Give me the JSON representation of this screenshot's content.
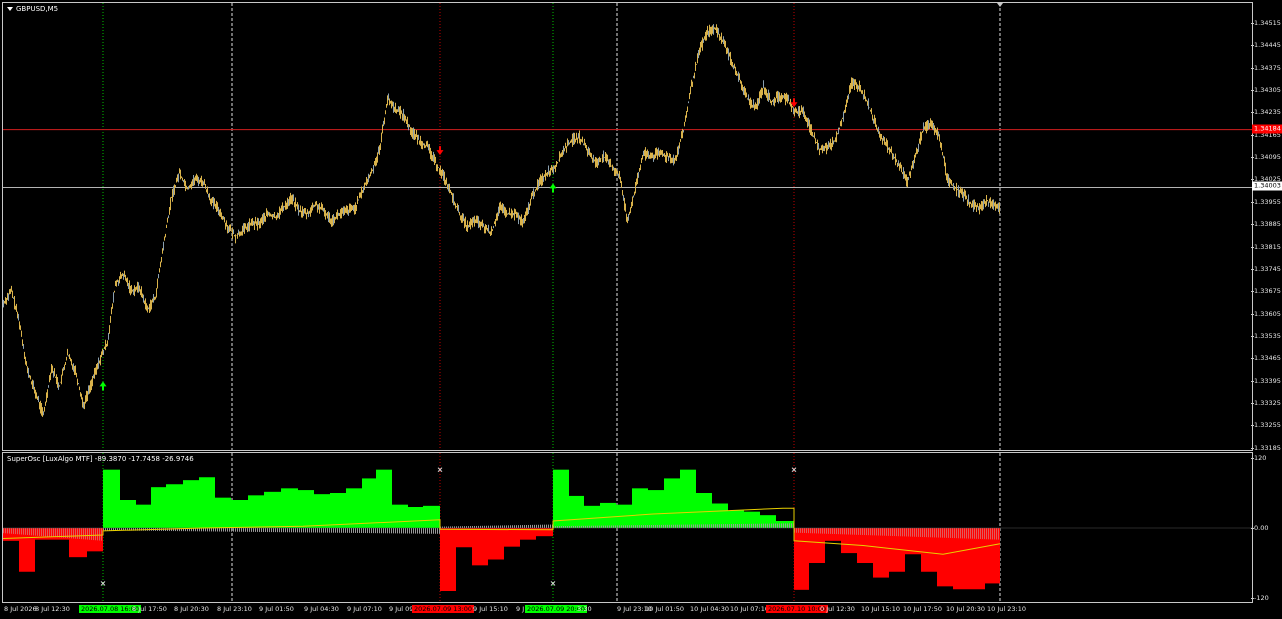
{
  "chart_title": "GBPUSD,M5",
  "osc_title": "SuperOsc [LuxAlgo MTF] -89.3870 -17.7458 -26.9746",
  "colors": {
    "bull": "#00ff00",
    "bear": "#ff0000",
    "candle": "#d9b24a",
    "signal": "#e8d000",
    "neutral_hist": "#9a9a9a",
    "red_line": "#d21e1e",
    "grid_white": "#e0e0e0",
    "tag_red": "#ff0000",
    "tag_green": "#00ff00"
  },
  "price_axis": {
    "ticks": [
      "1.34515",
      "1.34445",
      "1.34375",
      "1.34305",
      "1.34235",
      "1.34165",
      "1.34095",
      "1.34025",
      "1.33955",
      "1.33885",
      "1.33815",
      "1.33745",
      "1.33675",
      "1.33605",
      "1.33535",
      "1.33465",
      "1.33395",
      "1.33325",
      "1.33255",
      "1.33185"
    ],
    "red_line_label": "1.34184",
    "white_line_label": "1.34003"
  },
  "osc_axis": {
    "ticks": [
      "120",
      "0.00",
      "-120"
    ]
  },
  "time_axis": {
    "labels": [
      "8 Jul 2026",
      "8 Jul 12:30",
      "2026.07.08 16:00",
      "8 Jul 17:50",
      "8 Jul 20:30",
      "8 Jul 23:10",
      "9 Jul 01:50",
      "9 Jul 04:30",
      "9 Jul 07:10",
      "9 Jul 09:",
      "2026.07.09 13:00",
      "9 Jul 15:10",
      "9 J",
      "2026.07.09 20:00",
      "3:30",
      "9 Jul 23:10",
      "10 Jul 01:50",
      "10 Jul 04:30",
      "10 Jul 07:10",
      "2026.07.10 10:00",
      "0 Jul 12:30",
      "10 Jul 15:10",
      "10 Jul 17:50",
      "10 Jul 20:30",
      "10 Jul 23:10"
    ]
  },
  "chart_data": [
    {
      "type": "line",
      "title": "GBPUSD,M5",
      "ylim": [
        1.3316,
        1.3455
      ],
      "horizontal_lines": [
        1.34184,
        1.34003
      ],
      "series": [
        {
          "name": "GBPUSD,M5",
          "x": [
            0,
            8,
            16,
            24,
            32,
            40,
            48,
            56,
            64,
            72,
            80,
            88,
            96,
            104,
            112,
            120,
            128,
            136,
            144,
            152,
            160,
            168,
            176,
            184,
            192,
            200,
            208,
            216,
            224,
            232,
            240,
            248,
            256,
            264,
            272,
            280,
            288,
            296,
            304,
            312,
            320,
            328,
            336,
            344,
            352,
            360,
            368,
            376,
            384,
            392,
            400,
            408,
            416,
            424,
            432,
            440,
            448,
            456,
            464,
            472,
            480,
            488,
            496,
            504,
            512,
            520,
            528,
            536,
            544,
            552,
            560,
            568,
            576,
            584,
            592,
            600,
            608,
            616,
            624,
            632,
            640,
            648,
            656,
            664,
            672,
            680,
            688,
            696,
            704,
            712,
            720,
            728,
            736,
            744,
            752,
            760,
            768,
            776,
            784,
            792,
            800,
            808,
            816,
            824,
            832,
            840,
            848,
            856,
            864,
            872,
            880,
            888,
            896,
            904,
            912,
            920,
            928,
            936,
            944,
            952,
            960,
            968,
            976,
            984,
            992,
            997
          ],
          "y": [
            1.3364,
            1.3368,
            1.3358,
            1.3343,
            1.3336,
            1.3329,
            1.3344,
            1.3338,
            1.3348,
            1.3343,
            1.3332,
            1.3339,
            1.3346,
            1.3352,
            1.337,
            1.3373,
            1.3368,
            1.3369,
            1.3362,
            1.3366,
            1.3382,
            1.3397,
            1.3405,
            1.34,
            1.3403,
            1.3402,
            1.3396,
            1.3393,
            1.3388,
            1.3385,
            1.3387,
            1.3389,
            1.3389,
            1.3392,
            1.3391,
            1.3394,
            1.3397,
            1.3393,
            1.3392,
            1.3395,
            1.3393,
            1.339,
            1.3392,
            1.3393,
            1.3394,
            1.34,
            1.3405,
            1.3412,
            1.3428,
            1.3425,
            1.3423,
            1.3418,
            1.3415,
            1.3413,
            1.3408,
            1.3404,
            1.3398,
            1.3392,
            1.3388,
            1.339,
            1.3388,
            1.3386,
            1.3394,
            1.3392,
            1.3392,
            1.3389,
            1.3397,
            1.3402,
            1.3405,
            1.3407,
            1.3412,
            1.3415,
            1.3416,
            1.3412,
            1.3408,
            1.341,
            1.3407,
            1.3404,
            1.339,
            1.34,
            1.3411,
            1.341,
            1.3411,
            1.341,
            1.3409,
            1.3418,
            1.3432,
            1.3443,
            1.3449,
            1.345,
            1.3446,
            1.344,
            1.3434,
            1.3428,
            1.3425,
            1.3432,
            1.3427,
            1.3429,
            1.3428,
            1.3424,
            1.3424,
            1.3418,
            1.3412,
            1.3413,
            1.3415,
            1.3423,
            1.3433,
            1.3432,
            1.3427,
            1.342,
            1.3415,
            1.3411,
            1.3407,
            1.3402,
            1.341,
            1.3419,
            1.342,
            1.3416,
            1.3403,
            1.34,
            1.3398,
            1.3395,
            1.3394,
            1.3396,
            1.3395,
            1.3394
          ]
        }
      ],
      "markers": [
        {
          "x": 100,
          "y": 1.3338,
          "type": "up",
          "color": "#00ff00"
        },
        {
          "x": 437,
          "y": 1.3412,
          "type": "down",
          "color": "#ff0000"
        },
        {
          "x": 550,
          "y": 1.34,
          "type": "up",
          "color": "#00ff00"
        },
        {
          "x": 791,
          "y": 1.3427,
          "type": "down",
          "color": "#ff0000"
        }
      ],
      "session_lines": [
        {
          "x": 100,
          "style": "dotted",
          "color": "#00c000"
        },
        {
          "x": 229,
          "style": "dashed",
          "color": "#e0e0e0"
        },
        {
          "x": 437,
          "style": "dotted",
          "color": "#c00000"
        },
        {
          "x": 550,
          "style": "dotted",
          "color": "#00c000"
        },
        {
          "x": 614,
          "style": "dashed",
          "color": "#e0e0e0"
        },
        {
          "x": 791,
          "style": "dotted",
          "color": "#c00000"
        },
        {
          "x": 997,
          "style": "dashed",
          "color": "#e0e0e0"
        }
      ]
    },
    {
      "type": "bar",
      "title": "SuperOsc [LuxAlgo MTF] -89.3870 -17.7458 -26.9746",
      "ylim": [
        -120,
        120
      ],
      "bars": [
        {
          "x0": 0,
          "x1": 16,
          "v": -22
        },
        {
          "x0": 16,
          "x1": 32,
          "v": -75
        },
        {
          "x0": 32,
          "x1": 50,
          "v": -20
        },
        {
          "x0": 50,
          "x1": 66,
          "v": -20
        },
        {
          "x0": 66,
          "x1": 84,
          "v": -50
        },
        {
          "x0": 84,
          "x1": 100,
          "v": -40
        },
        {
          "x0": 100,
          "x1": 117,
          "v": 100
        },
        {
          "x0": 117,
          "x1": 133,
          "v": 48
        },
        {
          "x0": 133,
          "x1": 148,
          "v": 40
        },
        {
          "x0": 148,
          "x1": 163,
          "v": 70
        },
        {
          "x0": 163,
          "x1": 180,
          "v": 75
        },
        {
          "x0": 180,
          "x1": 196,
          "v": 82
        },
        {
          "x0": 196,
          "x1": 212,
          "v": 87
        },
        {
          "x0": 212,
          "x1": 228,
          "v": 52
        },
        {
          "x0": 228,
          "x1": 245,
          "v": 48
        },
        {
          "x0": 245,
          "x1": 261,
          "v": 56
        },
        {
          "x0": 261,
          "x1": 278,
          "v": 62
        },
        {
          "x0": 278,
          "x1": 295,
          "v": 68
        },
        {
          "x0": 295,
          "x1": 311,
          "v": 65
        },
        {
          "x0": 311,
          "x1": 327,
          "v": 58
        },
        {
          "x0": 327,
          "x1": 343,
          "v": 60
        },
        {
          "x0": 343,
          "x1": 359,
          "v": 68
        },
        {
          "x0": 359,
          "x1": 373,
          "v": 85
        },
        {
          "x0": 373,
          "x1": 389,
          "v": 100
        },
        {
          "x0": 389,
          "x1": 405,
          "v": 40
        },
        {
          "x0": 405,
          "x1": 420,
          "v": 36
        },
        {
          "x0": 420,
          "x1": 437,
          "v": 38
        },
        {
          "x0": 437,
          "x1": 453,
          "v": -108
        },
        {
          "x0": 453,
          "x1": 469,
          "v": -33
        },
        {
          "x0": 469,
          "x1": 485,
          "v": -64
        },
        {
          "x0": 485,
          "x1": 501,
          "v": -54
        },
        {
          "x0": 501,
          "x1": 517,
          "v": -32
        },
        {
          "x0": 517,
          "x1": 533,
          "v": -20
        },
        {
          "x0": 533,
          "x1": 550,
          "v": -14
        },
        {
          "x0": 550,
          "x1": 566,
          "v": 100
        },
        {
          "x0": 566,
          "x1": 581,
          "v": 55
        },
        {
          "x0": 581,
          "x1": 597,
          "v": 38
        },
        {
          "x0": 597,
          "x1": 613,
          "v": 43
        },
        {
          "x0": 613,
          "x1": 629,
          "v": 40
        },
        {
          "x0": 629,
          "x1": 645,
          "v": 68
        },
        {
          "x0": 645,
          "x1": 661,
          "v": 65
        },
        {
          "x0": 661,
          "x1": 677,
          "v": 85
        },
        {
          "x0": 677,
          "x1": 693,
          "v": 100
        },
        {
          "x0": 693,
          "x1": 709,
          "v": 60
        },
        {
          "x0": 709,
          "x1": 725,
          "v": 42
        },
        {
          "x0": 725,
          "x1": 741,
          "v": 30
        },
        {
          "x0": 741,
          "x1": 757,
          "v": 28
        },
        {
          "x0": 757,
          "x1": 773,
          "v": 22
        },
        {
          "x0": 773,
          "x1": 791,
          "v": 12
        },
        {
          "x0": 791,
          "x1": 806,
          "v": -106
        },
        {
          "x0": 806,
          "x1": 822,
          "v": -60
        },
        {
          "x0": 822,
          "x1": 838,
          "v": -22
        },
        {
          "x0": 838,
          "x1": 854,
          "v": -43
        },
        {
          "x0": 854,
          "x1": 870,
          "v": -60
        },
        {
          "x0": 870,
          "x1": 886,
          "v": -85
        },
        {
          "x0": 886,
          "x1": 902,
          "v": -75
        },
        {
          "x0": 902,
          "x1": 918,
          "v": -45
        },
        {
          "x0": 918,
          "x1": 934,
          "v": -75
        },
        {
          "x0": 934,
          "x1": 950,
          "v": -100
        },
        {
          "x0": 950,
          "x1": 966,
          "v": -105
        },
        {
          "x0": 966,
          "x1": 982,
          "v": -105
        },
        {
          "x0": 982,
          "x1": 997,
          "v": -95
        }
      ],
      "signal_line": {
        "x": [
          0,
          100,
          100,
          200,
          300,
          437,
          437,
          550,
          550,
          650,
          780,
          791,
          791,
          860,
          940,
          997
        ],
        "y": [
          -18,
          -12,
          -5,
          0,
          3,
          14,
          -2,
          -3,
          12,
          24,
          34,
          34,
          -22,
          -30,
          -45,
          -27
        ]
      },
      "neutral_hist": [
        {
          "x0": 0,
          "x1": 100,
          "v": -22,
          "color": "#e05a5a"
        },
        {
          "x0": 100,
          "x1": 437,
          "v": -10,
          "color": "#9a9a9a"
        },
        {
          "x0": 437,
          "x1": 550,
          "v": 6,
          "color": "#9a9a9a"
        },
        {
          "x0": 550,
          "x1": 791,
          "v": 8,
          "color": "#9a9a9a"
        },
        {
          "x0": 791,
          "x1": 997,
          "v": -20,
          "color": "#e05a5a"
        }
      ],
      "cross_markers": [
        {
          "x": 100,
          "v": -95
        },
        {
          "x": 437,
          "v": 100
        },
        {
          "x": 550,
          "v": -95
        },
        {
          "x": 791,
          "v": 100
        }
      ]
    }
  ]
}
